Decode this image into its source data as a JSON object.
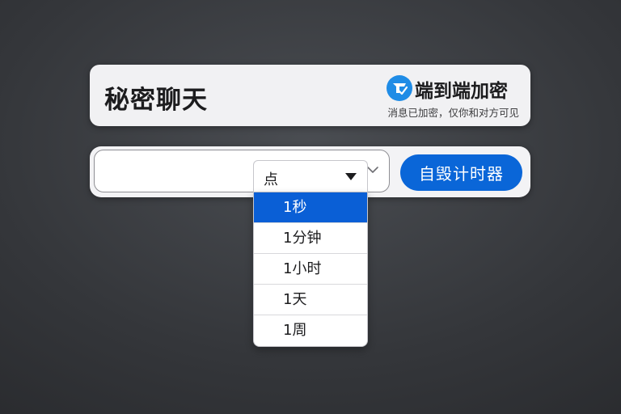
{
  "header": {
    "title": "秘密聊天",
    "encryption_label": "端到端加密",
    "encryption_note": "消息已加密，仅你和对方可见"
  },
  "composer": {
    "message_value": "",
    "timer_button_label": "自毁计时器"
  },
  "timer_select": {
    "selected_value": "点",
    "options": [
      {
        "label": "1秒",
        "highlighted": true
      },
      {
        "label": "1分钟",
        "highlighted": false
      },
      {
        "label": "1小时",
        "highlighted": false
      },
      {
        "label": "1天",
        "highlighted": false
      },
      {
        "label": "1周",
        "highlighted": false
      }
    ]
  },
  "colors": {
    "accent": "#0a66d8",
    "highlight": "#0a5fd6",
    "card_background": "#f1f1f3"
  },
  "icons": {
    "logo": "shield-check-icon",
    "input_dropdown": "chevron-down-icon",
    "select_caret": "caret-down-icon"
  }
}
